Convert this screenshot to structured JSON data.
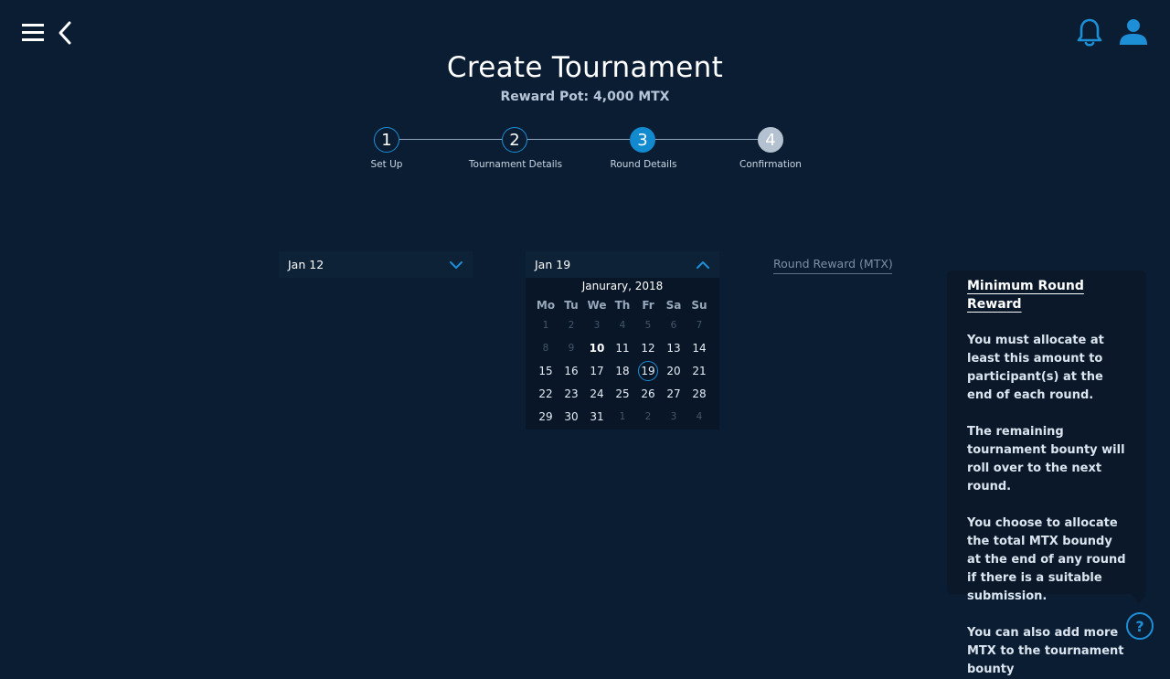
{
  "header": {
    "title": "Create Tournament",
    "subtitle": "Reward Pot: 4,000 MTX",
    "icons": [
      "menu-icon",
      "back-icon",
      "bell-icon",
      "user-icon"
    ]
  },
  "stepper": {
    "steps": [
      {
        "number": "1",
        "label": "Set Up",
        "state": "done"
      },
      {
        "number": "2",
        "label": "Tournament Details",
        "state": "done"
      },
      {
        "number": "3",
        "label": "Round Details",
        "state": "active"
      },
      {
        "number": "4",
        "label": "Confirmation",
        "state": "future"
      }
    ]
  },
  "round": {
    "start_date": "Jan 12",
    "end_date": "Jan 19",
    "reward_placeholder": "Round Reward (MTX)"
  },
  "calendar": {
    "month_label": "Janurary, 2018",
    "weekdays": [
      "Mo",
      "Tu",
      "We",
      "Th",
      "Fr",
      "Sa",
      "Su"
    ],
    "days": [
      {
        "d": "1",
        "muted": true
      },
      {
        "d": "2",
        "muted": true
      },
      {
        "d": "3",
        "muted": true
      },
      {
        "d": "4",
        "muted": true
      },
      {
        "d": "5",
        "muted": true
      },
      {
        "d": "6",
        "muted": true
      },
      {
        "d": "7",
        "muted": true
      },
      {
        "d": "8",
        "muted": true
      },
      {
        "d": "9",
        "muted": true
      },
      {
        "d": "10",
        "today": true
      },
      {
        "d": "11"
      },
      {
        "d": "12"
      },
      {
        "d": "13"
      },
      {
        "d": "14"
      },
      {
        "d": "15"
      },
      {
        "d": "16"
      },
      {
        "d": "17"
      },
      {
        "d": "18"
      },
      {
        "d": "19",
        "selected": true
      },
      {
        "d": "20"
      },
      {
        "d": "21"
      },
      {
        "d": "22"
      },
      {
        "d": "23"
      },
      {
        "d": "24"
      },
      {
        "d": "25"
      },
      {
        "d": "26"
      },
      {
        "d": "27"
      },
      {
        "d": "28"
      },
      {
        "d": "29"
      },
      {
        "d": "30"
      },
      {
        "d": "31"
      },
      {
        "d": "1",
        "muted": true
      },
      {
        "d": "2",
        "muted": true
      },
      {
        "d": "3",
        "muted": true
      },
      {
        "d": "4",
        "muted": true
      }
    ]
  },
  "tooltip": {
    "title": "Minimum Round Reward",
    "paragraphs": [
      "You must allocate at least this amount to participant(s) at the end of each round.",
      "The remaining tournament bounty will roll over to the next round.",
      "You choose to allocate the total MTX boundy at the end of any round if there is a suitable submission.",
      "You can also add more MTX to the tournament bounty"
    ]
  },
  "help": {
    "label": "?"
  },
  "colors": {
    "background": "#0b1d33",
    "accent": "#1c8fd6",
    "active_step": "#128ad0",
    "future_step": "#b3c1d0"
  }
}
